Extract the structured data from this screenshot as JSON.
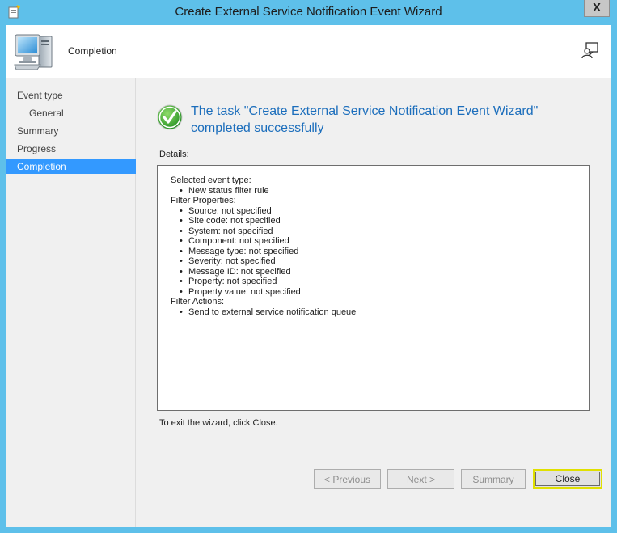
{
  "window": {
    "title": "Create External Service Notification Event Wizard",
    "close_glyph": "X"
  },
  "header": {
    "title": "Completion",
    "icon": "computer-icon",
    "right_icon": "feedback-icon"
  },
  "sidebar": {
    "items": [
      {
        "label": "Event type",
        "sub": false,
        "active": false
      },
      {
        "label": "General",
        "sub": true,
        "active": false
      },
      {
        "label": "Summary",
        "sub": false,
        "active": false
      },
      {
        "label": "Progress",
        "sub": false,
        "active": false
      },
      {
        "label": "Completion",
        "sub": false,
        "active": true
      }
    ]
  },
  "main": {
    "success_line1": "The task \"Create External Service Notification Event Wizard\"",
    "success_line2": "completed successfully",
    "details_label": "Details:",
    "details": {
      "selected_event_type_label": "Selected event type:",
      "selected_event_type_items": [
        "New status filter rule"
      ],
      "filter_properties_label": "Filter Properties:",
      "filter_properties_items": [
        "Source: not specified",
        "Site code: not specified",
        "System: not specified",
        "Component: not specified",
        "Message type: not specified",
        "Severity: not specified",
        "Message ID: not specified",
        "Property: not specified",
        "Property value: not specified"
      ],
      "filter_actions_label": "Filter Actions:",
      "filter_actions_items": [
        "Send to external service notification queue"
      ]
    },
    "exit_text": "To exit the wizard, click Close."
  },
  "buttons": {
    "previous": "< Previous",
    "next": "Next >",
    "summary": "Summary",
    "close": "Close"
  },
  "colors": {
    "titlebar": "#5ec0ea",
    "accent_selected": "#3399ff",
    "success_text": "#1c6ebc",
    "close_focus": "#e0e000"
  }
}
